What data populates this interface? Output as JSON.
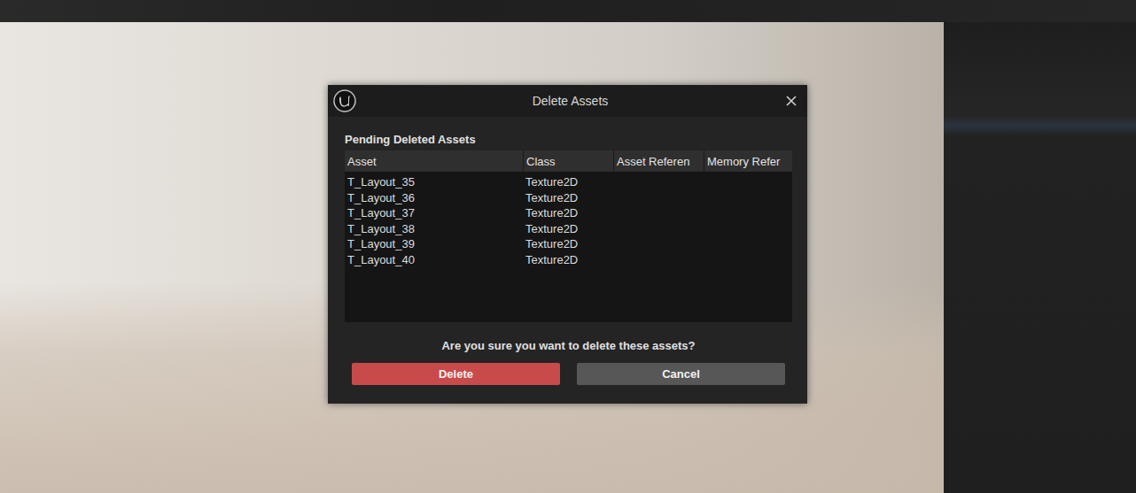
{
  "window": {
    "title": "Delete Assets"
  },
  "section": {
    "label": "Pending Deleted Assets"
  },
  "table": {
    "columns": [
      "Asset",
      "Class",
      "Asset Referen",
      "Memory Refer"
    ],
    "rows": [
      {
        "asset": "T_Layout_35",
        "class": "Texture2D",
        "selected": false
      },
      {
        "asset": "T_Layout_36",
        "class": "Texture2D",
        "selected": false
      },
      {
        "asset": "T_Layout_37",
        "class": "Texture2D",
        "selected": false
      },
      {
        "asset": "T_Layout_38",
        "class": "Texture2D",
        "selected": false
      },
      {
        "asset": "T_Layout_39",
        "class": "Texture2D",
        "selected": false
      },
      {
        "asset": "T_Layout_40",
        "class": "Texture2D",
        "selected": false
      }
    ]
  },
  "prompt": "Are you sure you want to delete these assets?",
  "buttons": [
    {
      "label": "Delete",
      "kind": "danger"
    },
    {
      "label": "Cancel",
      "kind": "normal"
    }
  ]
}
